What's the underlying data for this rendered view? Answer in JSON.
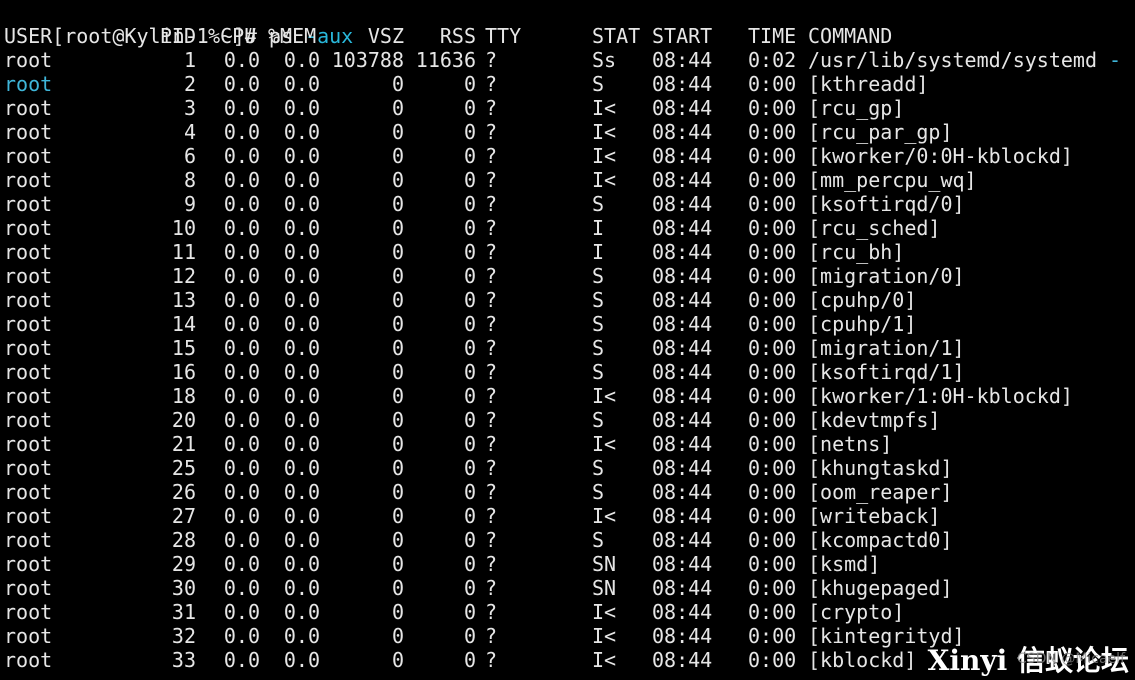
{
  "prompt": {
    "text": "[root@Kylin-1 ~]# ps ",
    "arg": "-aux"
  },
  "headers": {
    "user": "USER",
    "pid": "PID",
    "cpu": "%CPU",
    "mem": "%MEM",
    "vsz": "VSZ",
    "rss": "RSS",
    "tty": "TTY",
    "stat": "STAT",
    "start": "START",
    "time": "TIME",
    "command": "COMMAND"
  },
  "rows": [
    {
      "user": "root",
      "pid": "1",
      "cpu": "0.0",
      "mem": "0.0",
      "vsz": "103788",
      "rss": "11636",
      "tty": "?",
      "stat": "Ss",
      "start": "08:44",
      "time": "0:02",
      "command": "/usr/lib/systemd/systemd ",
      "command_suffix": "-"
    },
    {
      "user": "root",
      "pid": "2",
      "cpu": "0.0",
      "mem": "0.0",
      "vsz": "0",
      "rss": "0",
      "tty": "?",
      "stat": "S",
      "start": "08:44",
      "time": "0:00",
      "command": "[kthreadd]",
      "highlight": true
    },
    {
      "user": "root",
      "pid": "3",
      "cpu": "0.0",
      "mem": "0.0",
      "vsz": "0",
      "rss": "0",
      "tty": "?",
      "stat": "I<",
      "start": "08:44",
      "time": "0:00",
      "command": "[rcu_gp]"
    },
    {
      "user": "root",
      "pid": "4",
      "cpu": "0.0",
      "mem": "0.0",
      "vsz": "0",
      "rss": "0",
      "tty": "?",
      "stat": "I<",
      "start": "08:44",
      "time": "0:00",
      "command": "[rcu_par_gp]"
    },
    {
      "user": "root",
      "pid": "6",
      "cpu": "0.0",
      "mem": "0.0",
      "vsz": "0",
      "rss": "0",
      "tty": "?",
      "stat": "I<",
      "start": "08:44",
      "time": "0:00",
      "command": "[kworker/0:0H-kblockd]"
    },
    {
      "user": "root",
      "pid": "8",
      "cpu": "0.0",
      "mem": "0.0",
      "vsz": "0",
      "rss": "0",
      "tty": "?",
      "stat": "I<",
      "start": "08:44",
      "time": "0:00",
      "command": "[mm_percpu_wq]"
    },
    {
      "user": "root",
      "pid": "9",
      "cpu": "0.0",
      "mem": "0.0",
      "vsz": "0",
      "rss": "0",
      "tty": "?",
      "stat": "S",
      "start": "08:44",
      "time": "0:00",
      "command": "[ksoftirqd/0]"
    },
    {
      "user": "root",
      "pid": "10",
      "cpu": "0.0",
      "mem": "0.0",
      "vsz": "0",
      "rss": "0",
      "tty": "?",
      "stat": "I",
      "start": "08:44",
      "time": "0:00",
      "command": "[rcu_sched]"
    },
    {
      "user": "root",
      "pid": "11",
      "cpu": "0.0",
      "mem": "0.0",
      "vsz": "0",
      "rss": "0",
      "tty": "?",
      "stat": "I",
      "start": "08:44",
      "time": "0:00",
      "command": "[rcu_bh]"
    },
    {
      "user": "root",
      "pid": "12",
      "cpu": "0.0",
      "mem": "0.0",
      "vsz": "0",
      "rss": "0",
      "tty": "?",
      "stat": "S",
      "start": "08:44",
      "time": "0:00",
      "command": "[migration/0]"
    },
    {
      "user": "root",
      "pid": "13",
      "cpu": "0.0",
      "mem": "0.0",
      "vsz": "0",
      "rss": "0",
      "tty": "?",
      "stat": "S",
      "start": "08:44",
      "time": "0:00",
      "command": "[cpuhp/0]"
    },
    {
      "user": "root",
      "pid": "14",
      "cpu": "0.0",
      "mem": "0.0",
      "vsz": "0",
      "rss": "0",
      "tty": "?",
      "stat": "S",
      "start": "08:44",
      "time": "0:00",
      "command": "[cpuhp/1]"
    },
    {
      "user": "root",
      "pid": "15",
      "cpu": "0.0",
      "mem": "0.0",
      "vsz": "0",
      "rss": "0",
      "tty": "?",
      "stat": "S",
      "start": "08:44",
      "time": "0:00",
      "command": "[migration/1]"
    },
    {
      "user": "root",
      "pid": "16",
      "cpu": "0.0",
      "mem": "0.0",
      "vsz": "0",
      "rss": "0",
      "tty": "?",
      "stat": "S",
      "start": "08:44",
      "time": "0:00",
      "command": "[ksoftirqd/1]"
    },
    {
      "user": "root",
      "pid": "18",
      "cpu": "0.0",
      "mem": "0.0",
      "vsz": "0",
      "rss": "0",
      "tty": "?",
      "stat": "I<",
      "start": "08:44",
      "time": "0:00",
      "command": "[kworker/1:0H-kblockd]"
    },
    {
      "user": "root",
      "pid": "20",
      "cpu": "0.0",
      "mem": "0.0",
      "vsz": "0",
      "rss": "0",
      "tty": "?",
      "stat": "S",
      "start": "08:44",
      "time": "0:00",
      "command": "[kdevtmpfs]"
    },
    {
      "user": "root",
      "pid": "21",
      "cpu": "0.0",
      "mem": "0.0",
      "vsz": "0",
      "rss": "0",
      "tty": "?",
      "stat": "I<",
      "start": "08:44",
      "time": "0:00",
      "command": "[netns]"
    },
    {
      "user": "root",
      "pid": "25",
      "cpu": "0.0",
      "mem": "0.0",
      "vsz": "0",
      "rss": "0",
      "tty": "?",
      "stat": "S",
      "start": "08:44",
      "time": "0:00",
      "command": "[khungtaskd]"
    },
    {
      "user": "root",
      "pid": "26",
      "cpu": "0.0",
      "mem": "0.0",
      "vsz": "0",
      "rss": "0",
      "tty": "?",
      "stat": "S",
      "start": "08:44",
      "time": "0:00",
      "command": "[oom_reaper]"
    },
    {
      "user": "root",
      "pid": "27",
      "cpu": "0.0",
      "mem": "0.0",
      "vsz": "0",
      "rss": "0",
      "tty": "?",
      "stat": "I<",
      "start": "08:44",
      "time": "0:00",
      "command": "[writeback]"
    },
    {
      "user": "root",
      "pid": "28",
      "cpu": "0.0",
      "mem": "0.0",
      "vsz": "0",
      "rss": "0",
      "tty": "?",
      "stat": "S",
      "start": "08:44",
      "time": "0:00",
      "command": "[kcompactd0]"
    },
    {
      "user": "root",
      "pid": "29",
      "cpu": "0.0",
      "mem": "0.0",
      "vsz": "0",
      "rss": "0",
      "tty": "?",
      "stat": "SN",
      "start": "08:44",
      "time": "0:00",
      "command": "[ksmd]"
    },
    {
      "user": "root",
      "pid": "30",
      "cpu": "0.0",
      "mem": "0.0",
      "vsz": "0",
      "rss": "0",
      "tty": "?",
      "stat": "SN",
      "start": "08:44",
      "time": "0:00",
      "command": "[khugepaged]"
    },
    {
      "user": "root",
      "pid": "31",
      "cpu": "0.0",
      "mem": "0.0",
      "vsz": "0",
      "rss": "0",
      "tty": "?",
      "stat": "I<",
      "start": "08:44",
      "time": "0:00",
      "command": "[crypto]"
    },
    {
      "user": "root",
      "pid": "32",
      "cpu": "0.0",
      "mem": "0.0",
      "vsz": "0",
      "rss": "0",
      "tty": "?",
      "stat": "I<",
      "start": "08:44",
      "time": "0:00",
      "command": "[kintegrityd]"
    },
    {
      "user": "root",
      "pid": "33",
      "cpu": "0.0",
      "mem": "0.0",
      "vsz": "0",
      "rss": "0",
      "tty": "?",
      "stat": "I<",
      "start": "08:44",
      "time": "0:00",
      "command": "[kblockd]"
    }
  ],
  "watermark": {
    "main": "Xinyi 信蚁论坛",
    "sub": "CSDN @Micaelf"
  },
  "colors": {
    "background": "#000000",
    "foreground": "#e6e6e6",
    "accent": "#29b8db"
  }
}
